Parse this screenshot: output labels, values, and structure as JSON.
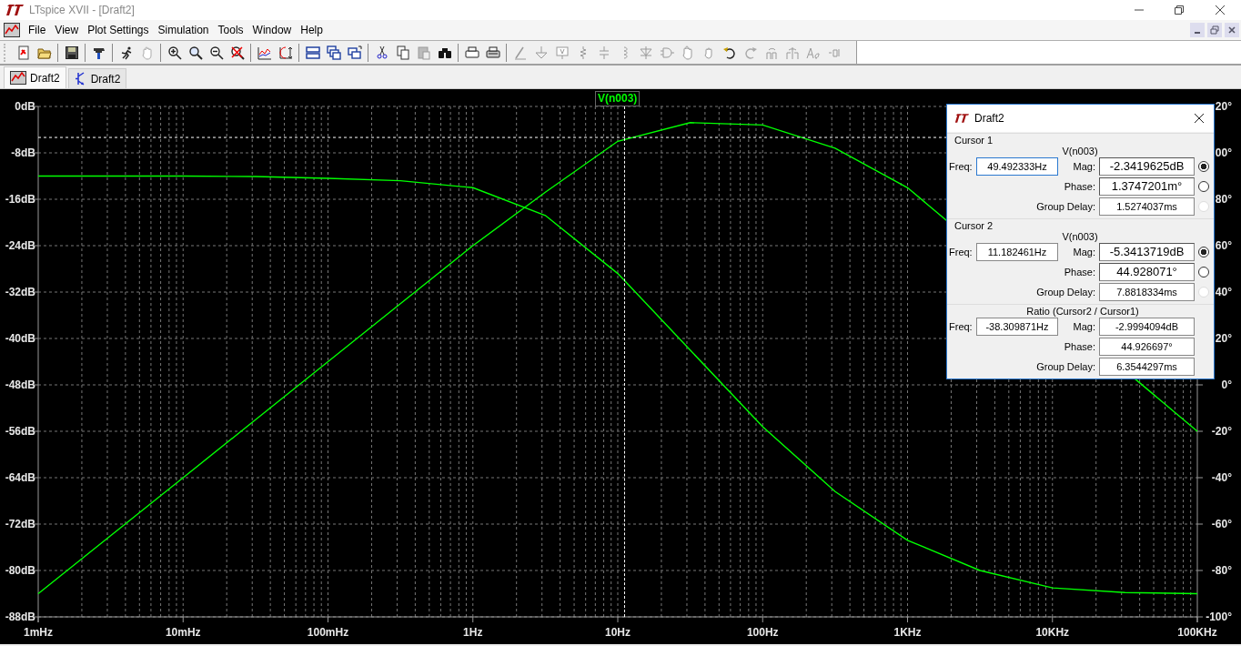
{
  "window": {
    "title": "LTspice XVII - [Draft2]"
  },
  "menu": [
    "File",
    "View",
    "Plot Settings",
    "Simulation",
    "Tools",
    "Window",
    "Help"
  ],
  "tabs": [
    {
      "label": "Draft2",
      "kind": "waveform",
      "selected": true
    },
    {
      "label": "Draft2",
      "kind": "schematic",
      "selected": false
    }
  ],
  "plot": {
    "y2_partial_labels": [
      "20°",
      "00°"
    ],
    "chart_data": {
      "type": "line",
      "categories": [
        "1mHz",
        null,
        "10mHz",
        null,
        "100mHz",
        null,
        "1Hz",
        null,
        "10Hz",
        null,
        "100Hz",
        null,
        "1KHz",
        null,
        "10KHz",
        null,
        "100KHz"
      ],
      "series": [
        {
          "name": "V(n003)",
          "color": "#00ff00",
          "values": [
            -84,
            -74,
            -64,
            -54,
            -44,
            -34,
            -24,
            -14.8,
            -6,
            -2.8,
            -3.2,
            -7.2,
            -14,
            null,
            null,
            null,
            -56
          ]
        },
        {
          "color": "#00ff00",
          "axis": "y2",
          "values": [
            90,
            90,
            90,
            89.8,
            89,
            88,
            85,
            73,
            48,
            15,
            -18,
            -46,
            -67,
            -80,
            -87.5,
            -89.5,
            -90
          ]
        }
      ],
      "ylim": [
        -88,
        0
      ],
      "y2lim": [
        -100,
        120
      ],
      "yticks": [
        {
          "value": 0,
          "label": "0dB"
        },
        {
          "value": -8,
          "label": "-8dB"
        },
        {
          "value": -16,
          "label": "-16dB"
        },
        {
          "value": -24,
          "label": "-24dB"
        },
        {
          "value": -32,
          "label": "-32dB"
        },
        {
          "value": -40,
          "label": "-40dB"
        },
        {
          "value": -48,
          "label": "-48dB"
        },
        {
          "value": -56,
          "label": "-56dB"
        },
        {
          "value": -64,
          "label": "-64dB"
        },
        {
          "value": -72,
          "label": "-72dB"
        },
        {
          "value": -80,
          "label": "-80dB"
        },
        {
          "value": -88,
          "label": "-88dB"
        }
      ],
      "y2ticks": [
        {
          "value": 80,
          "label": "80°"
        },
        {
          "value": 60,
          "label": "60°"
        },
        {
          "value": 40,
          "label": "40°"
        },
        {
          "value": 20,
          "label": "20°"
        },
        {
          "value": 0,
          "label": "0°"
        },
        {
          "value": -20,
          "label": "-20°"
        },
        {
          "value": -40,
          "label": "-40°"
        },
        {
          "value": -60,
          "label": "-60°"
        },
        {
          "value": -80,
          "label": "-80°"
        },
        {
          "value": -100,
          "label": "-100°"
        }
      ],
      "grid": true,
      "ref_lines": [
        {
          "axis": "y",
          "value": -5.3413719
        }
      ]
    }
  },
  "cursor_dialog": {
    "title": "Draft2",
    "sections": [
      {
        "kind": "cursor",
        "heading": "Cursor 1",
        "trace": "V(n003)",
        "freq_label": "Freq:",
        "freq": "49.492333Hz",
        "freq_focused": true,
        "rows": [
          {
            "label": "Mag:",
            "value": "-2.3419625dB",
            "selected": true,
            "disabled": false
          },
          {
            "label": "Phase:",
            "value": "1.3747201m°",
            "selected": false,
            "disabled": false
          },
          {
            "label": "Group Delay:",
            "value": "1.5274037ms",
            "selected": false,
            "disabled": true
          }
        ]
      },
      {
        "kind": "cursor",
        "heading": "Cursor 2",
        "trace": "V(n003)",
        "freq_label": "Freq:",
        "freq": "11.182461Hz",
        "freq_focused": false,
        "rows": [
          {
            "label": "Mag:",
            "value": "-5.3413719dB",
            "selected": true,
            "disabled": false
          },
          {
            "label": "Phase:",
            "value": "44.928071°",
            "selected": false,
            "disabled": false
          },
          {
            "label": "Group Delay:",
            "value": "7.8818334ms",
            "selected": false,
            "disabled": true
          }
        ]
      },
      {
        "kind": "ratio",
        "heading": "Ratio (Cursor2 / Cursor1)",
        "freq_label": "Freq:",
        "freq": "-38.309871Hz",
        "freq_focused": false,
        "rows": [
          {
            "label": "Mag:",
            "value": "-2.9994094dB"
          },
          {
            "label": "Phase:",
            "value": "44.926697°"
          },
          {
            "label": "Group Delay:",
            "value": "6.3544297ms"
          }
        ]
      }
    ]
  }
}
